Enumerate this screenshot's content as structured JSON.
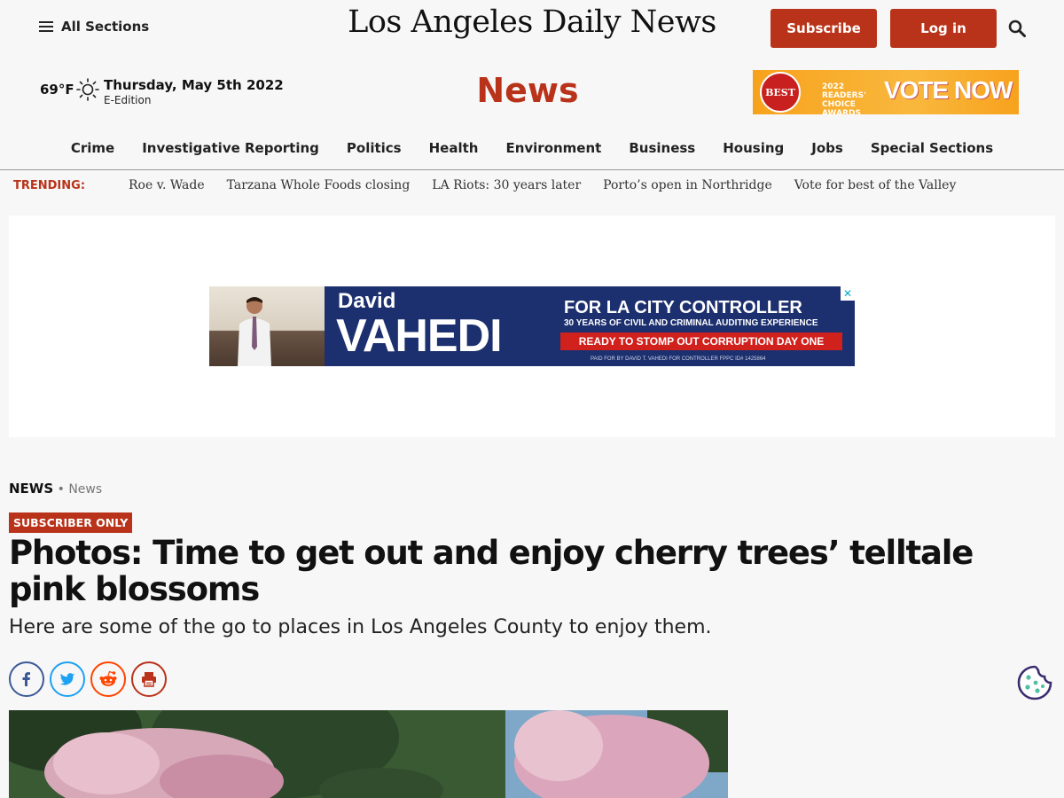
{
  "header": {
    "all_sections_label": "All Sections",
    "masthead": "Los Angeles Daily News",
    "subscribe_label": "Subscribe",
    "login_label": "Log in",
    "weather_temp": "69°F",
    "date": "Thursday, May 5th 2022",
    "eedition_label": "E-Edition",
    "section_title": "News",
    "accent_color": "#b9331a"
  },
  "top_ad": {
    "badge_text": "BEST",
    "small_text": "2022 READERS' CHOICE AWARDS",
    "cta": "VOTE NOW"
  },
  "nav": {
    "items": [
      "Crime",
      "Investigative Reporting",
      "Politics",
      "Health",
      "Environment",
      "Business",
      "Housing",
      "Jobs",
      "Special Sections"
    ]
  },
  "trending": {
    "label": "TRENDING:",
    "items": [
      "Roe v. Wade",
      "Tarzana Whole Foods closing",
      "LA Riots: 30 years later",
      "Porto’s open in Northridge",
      "Vote for best of the Valley"
    ]
  },
  "banner_ad": {
    "first_name": "David",
    "last_name": "VAHEDI",
    "headline": "FOR LA CITY CONTROLLER",
    "subline": "30 YEARS OF CIVIL AND CRIMINAL AUDITING EXPERIENCE",
    "red_line": "READY TO STOMP OUT CORRUPTION DAY ONE",
    "paid_for": "PAID FOR BY DAVID T. VAHEDI FOR CONTROLLER FPPC ID# 1425864",
    "close": "✕"
  },
  "article": {
    "breadcrumb_section": "NEWS",
    "breadcrumb_sep": " • ",
    "breadcrumb_sub": "News",
    "badge": "SUBSCRIBER ONLY",
    "headline": "Photos: Time to get out and enjoy cherry trees’ telltale pink blossoms",
    "dek": "Here are some of the go to places in Los Angeles County to enjoy them."
  },
  "share": {
    "icons": [
      "facebook-icon",
      "twitter-icon",
      "reddit-icon",
      "print-icon"
    ]
  }
}
